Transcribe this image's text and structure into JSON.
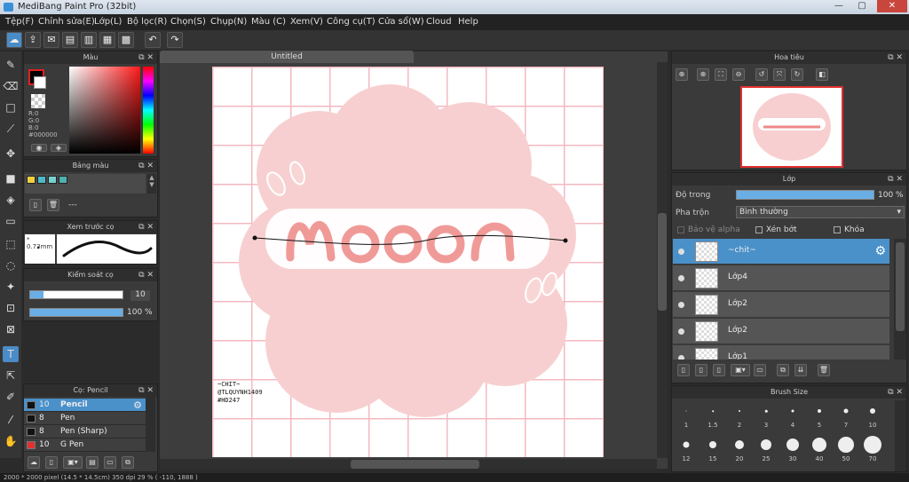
{
  "window": {
    "title": "MediBang Paint Pro (32bit)",
    "min": "—",
    "max": "▢",
    "close": "✕"
  },
  "menu": [
    "Tệp(F)",
    "Chỉnh sửa(E)",
    "Lớp(L)",
    "Bộ lọc(R)",
    "Chọn(S)",
    "Chụp(N)",
    "Màu (C)",
    "Xem(V)",
    "Công cụ(T)",
    "Cửa sổ(W)",
    "Cloud",
    "Help"
  ],
  "document": {
    "tab": "Untitled",
    "text_lines": [
      "~CHIT~",
      "@TLQUYNH1409",
      "#HD247"
    ]
  },
  "color_panel": {
    "title": "Màu",
    "r": "R:0",
    "g": "G:0",
    "b": "B:0",
    "hex": "#000000",
    "primary": "#000000"
  },
  "palette_panel": {
    "title": "Bảng màu",
    "selected": "---",
    "swatches": [
      "#f0d040",
      "#4db8c8",
      "#7ad0d0",
      "#4fb0b0"
    ]
  },
  "brush_preview": {
    "title": "Xem trước cọ",
    "size": "0.73mm"
  },
  "brush_control": {
    "title": "Kiểm soát cọ",
    "size_value": "10",
    "size_fill": 0.14,
    "opacity_value": "100 %",
    "opacity_fill": 1.0
  },
  "brush_list": {
    "title": "Cọ: Pencil",
    "items": [
      {
        "num": "10",
        "name": "Pencil",
        "color": "#111111",
        "selected": true
      },
      {
        "num": "8",
        "name": "Pen",
        "color": "#111111",
        "selected": false
      },
      {
        "num": "8",
        "name": "Pen (Sharp)",
        "color": "#111111",
        "selected": false
      },
      {
        "num": "10",
        "name": "G Pen",
        "color": "#e03030",
        "selected": false
      }
    ]
  },
  "navigator": {
    "title": "Hoa tiêu"
  },
  "layer_panel": {
    "title": "Lớp",
    "opacity_label": "Độ trong",
    "opacity_value": "100 %",
    "opacity_fill": 1.0,
    "blend_label": "Pha trộn",
    "blend_value": "Bình thường",
    "protect_alpha": "Bảo vệ alpha",
    "clipping": "Xén bớt",
    "lock": "Khóa",
    "layers": [
      {
        "name": "~chit~",
        "selected": true
      },
      {
        "name": "Lớp4",
        "selected": false
      },
      {
        "name": "Lớp2",
        "selected": false
      },
      {
        "name": "Lớp2",
        "selected": false
      },
      {
        "name": "Lớp1",
        "selected": false
      }
    ]
  },
  "brush_size": {
    "title": "Brush Size",
    "sizes": [
      "1",
      "1.5",
      "2",
      "3",
      "4",
      "5",
      "7",
      "10",
      "12",
      "15",
      "20",
      "25",
      "30",
      "40",
      "50",
      "70"
    ]
  },
  "status_bar": "2000 * 2000 pixel  (14.5 * 14.5cm)  350 dpi  29 %  ( -110, 1888 )"
}
